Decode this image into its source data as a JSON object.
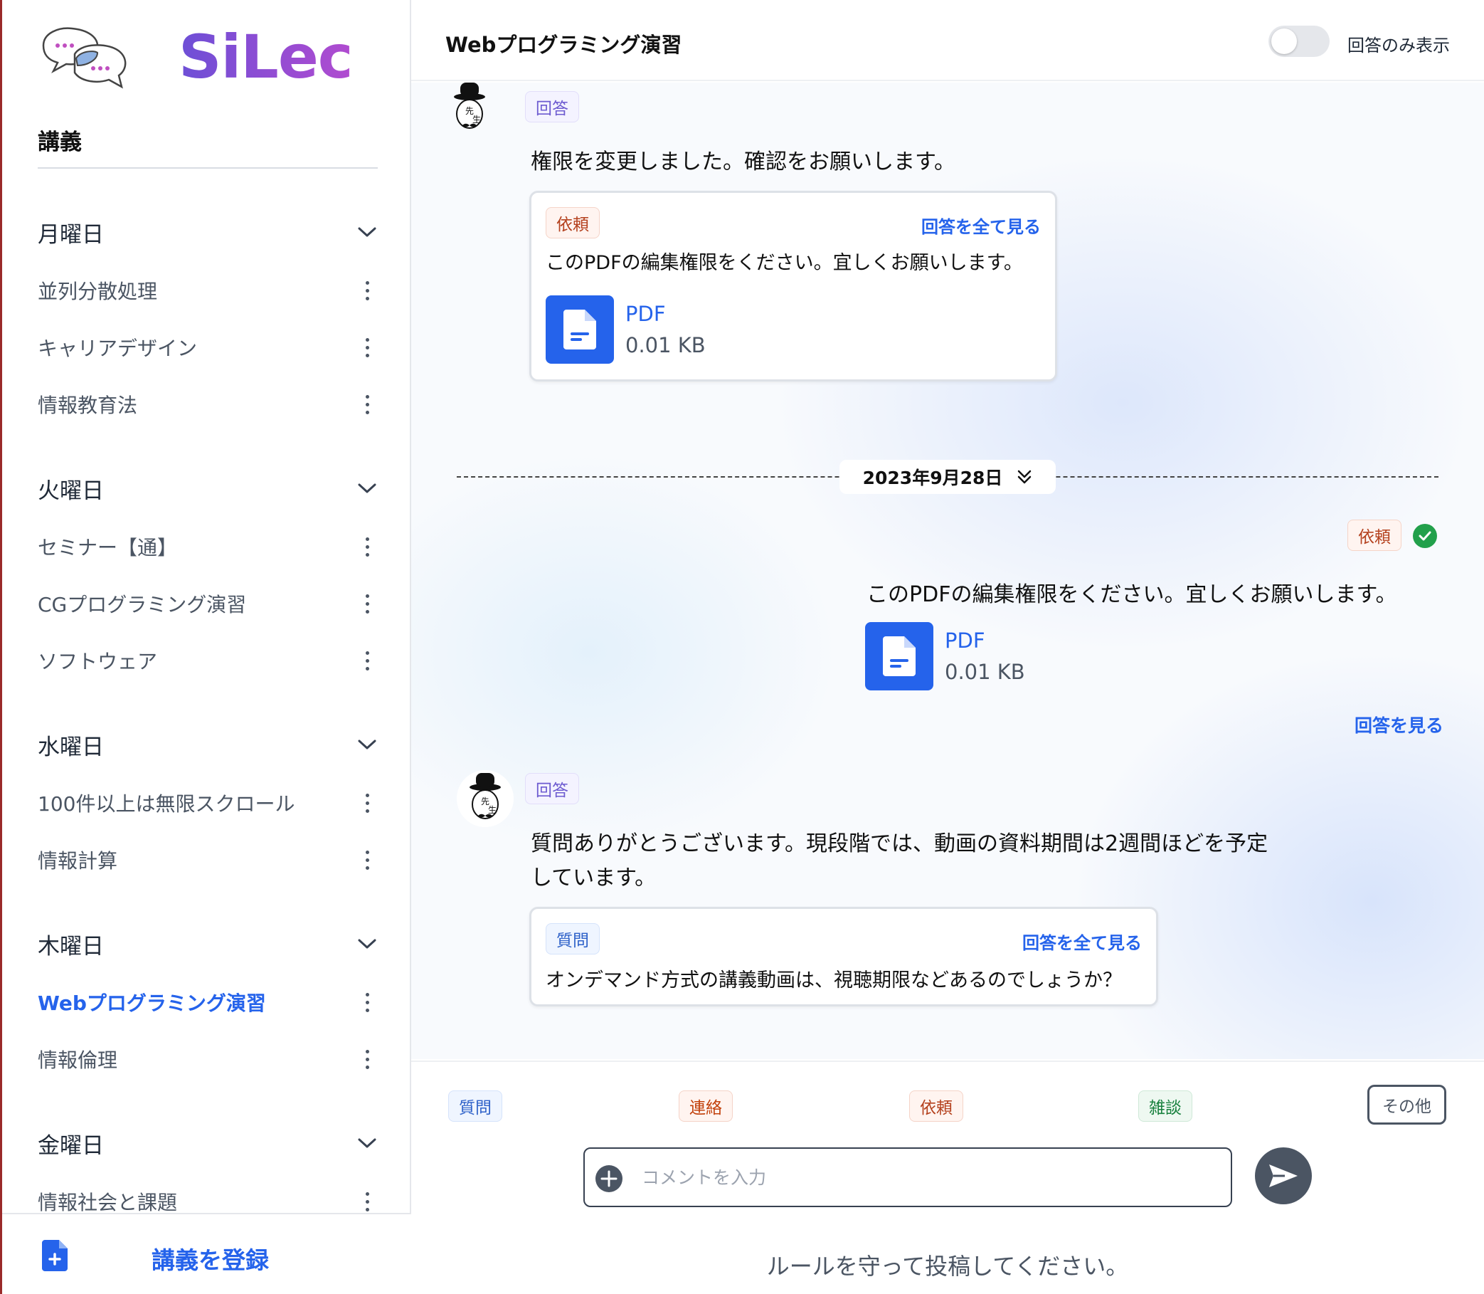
{
  "sidebar": {
    "brand": "SiLec",
    "section_title": "講義",
    "days": [
      {
        "label": "月曜日",
        "courses": [
          "並列分散処理",
          "キャリアデザイン",
          "情報教育法"
        ]
      },
      {
        "label": "火曜日",
        "courses": [
          "セミナー【通】",
          "CGプログラミング演習",
          "ソフトウェア"
        ]
      },
      {
        "label": "水曜日",
        "courses": [
          "100件以上は無限スクロール",
          "情報計算"
        ]
      },
      {
        "label": "木曜日",
        "courses": [
          "Webプログラミング演習",
          "情報倫理"
        ]
      },
      {
        "label": "金曜日",
        "courses": [
          "情報社会と課題"
        ]
      }
    ],
    "active_course": "Webプログラミング演習",
    "register_label": "講義を登録"
  },
  "header": {
    "title": "Webプログラミング演習",
    "toggle_label": "回答のみ表示",
    "toggle_on": false
  },
  "feed": {
    "message1": {
      "tag": "回答",
      "text": "権限を変更しました。確認をお願いします。",
      "quote": {
        "tag": "依頼",
        "link": "回答を全て見る",
        "text": "このPDFの編集権限をください。宜しくお願いします。",
        "file": {
          "name": "PDF",
          "size": "0.01 KB"
        }
      }
    },
    "date_divider": "2023年9月28日",
    "message2": {
      "tag": "依頼",
      "resolved": true,
      "text": "このPDFの編集権限をください。宜しくお願いします。",
      "file": {
        "name": "PDF",
        "size": "0.01 KB"
      },
      "link": "回答を見る"
    },
    "message3": {
      "tag": "回答",
      "text_line1": "質問ありがとうございます。現段階では、動画の資料期間は2週間ほどを予定",
      "text_line2": "しています。",
      "quote": {
        "tag": "質問",
        "link": "回答を全て見る",
        "text": "オンデマンド方式の講義動画は、視聴期限などあるのでしょうか？"
      }
    }
  },
  "composer": {
    "categories": [
      "質問",
      "連絡",
      "依頼",
      "雑談",
      "その他"
    ],
    "placeholder": "コメントを入力",
    "value": "",
    "rules": "ルールを守って投稿してください。"
  },
  "colors": {
    "accent": "#2563eb",
    "brand_from": "#6d4fd6",
    "brand_to": "#b14bd0",
    "resolved": "#22a04b"
  },
  "icons": {
    "logo": "speech-bubbles-logo",
    "chevron": "chevron-down-icon",
    "kebab": "kebab-menu-icon",
    "file": "document-icon",
    "send": "send-icon",
    "add": "plus-circle-icon",
    "check": "check-circle-icon",
    "register": "add-document-icon"
  }
}
